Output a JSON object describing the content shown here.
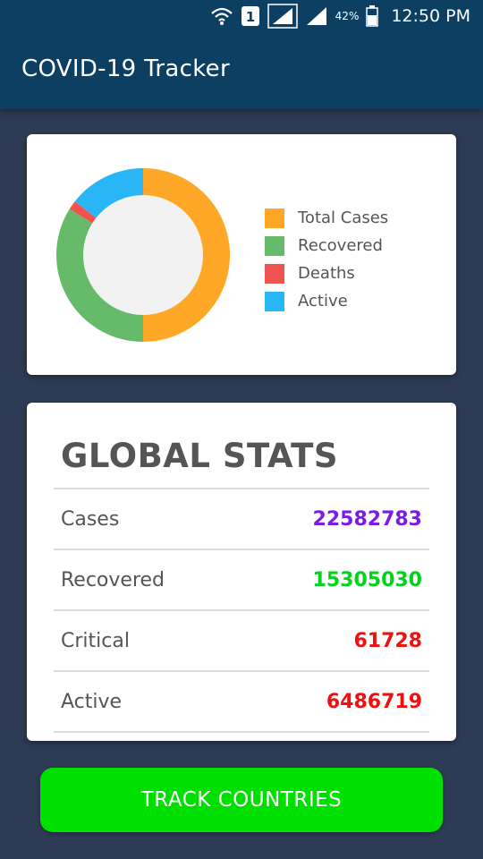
{
  "status_bar": {
    "battery_percent": "42%",
    "time": "12:50 PM",
    "sim_slot": "1",
    "icons": [
      "wifi-icon",
      "sim-icon",
      "signal-icon",
      "signal-icon",
      "battery-icon"
    ]
  },
  "app_bar": {
    "title": "COVID-19 Tracker"
  },
  "chart": {
    "legend": [
      {
        "label": "Total Cases",
        "color": "#ffa726"
      },
      {
        "label": "Recovered",
        "color": "#66bb6a"
      },
      {
        "label": "Deaths",
        "color": "#ef5350"
      },
      {
        "label": "Active",
        "color": "#29b6f6"
      }
    ]
  },
  "chart_data": {
    "type": "pie",
    "categories": [
      "Total Cases",
      "Recovered",
      "Deaths",
      "Active"
    ],
    "values": [
      22582783,
      15305030,
      790000,
      6486719
    ],
    "colors": [
      "#ffa726",
      "#66bb6a",
      "#ef5350",
      "#29b6f6"
    ],
    "legend_position": "right"
  },
  "global_stats": {
    "title": "GLOBAL STATS",
    "rows": [
      {
        "label": "Cases",
        "value": "22582783",
        "color": "#7a1be8"
      },
      {
        "label": "Recovered",
        "value": "15305030",
        "color": "#00d41a"
      },
      {
        "label": "Critical",
        "value": "61728",
        "color": "#f01010"
      },
      {
        "label": "Active",
        "value": "6486719",
        "color": "#f01010"
      }
    ]
  },
  "track_button": {
    "label": "TRACK COUNTRIES",
    "color": "#00e000"
  }
}
